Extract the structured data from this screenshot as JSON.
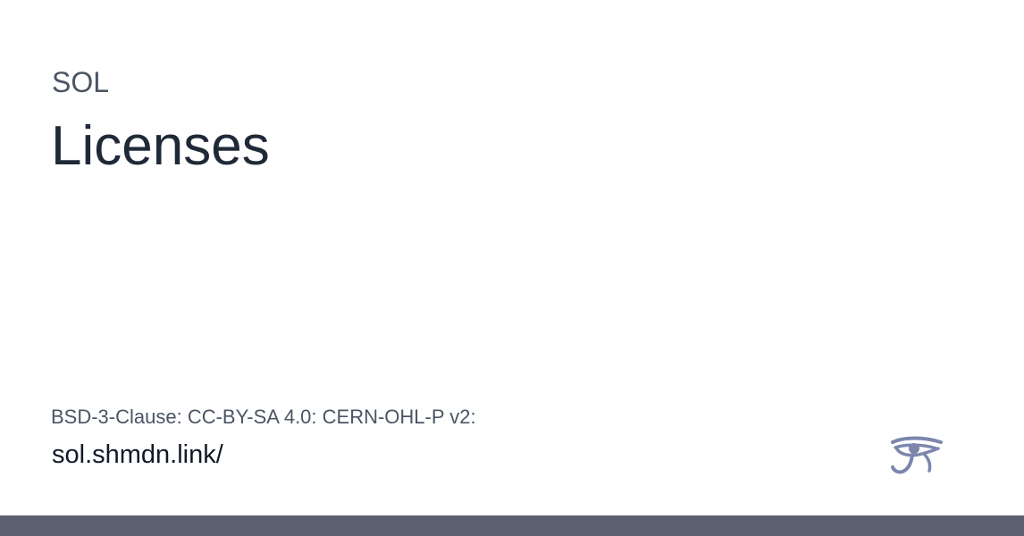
{
  "header": {
    "site_name": "SOL",
    "title": "Licenses"
  },
  "footer": {
    "description": "BSD-3-Clause: CC-BY-SA 4.0: CERN-OHL-P v2:",
    "url": "sol.shmdn.link/"
  },
  "logo": {
    "icon": "eye-of-horus-icon",
    "color": "#7c86ad"
  },
  "colors": {
    "bottom_bar": "#5b616e",
    "title": "#1f2937",
    "muted_text": "#4b5563"
  }
}
